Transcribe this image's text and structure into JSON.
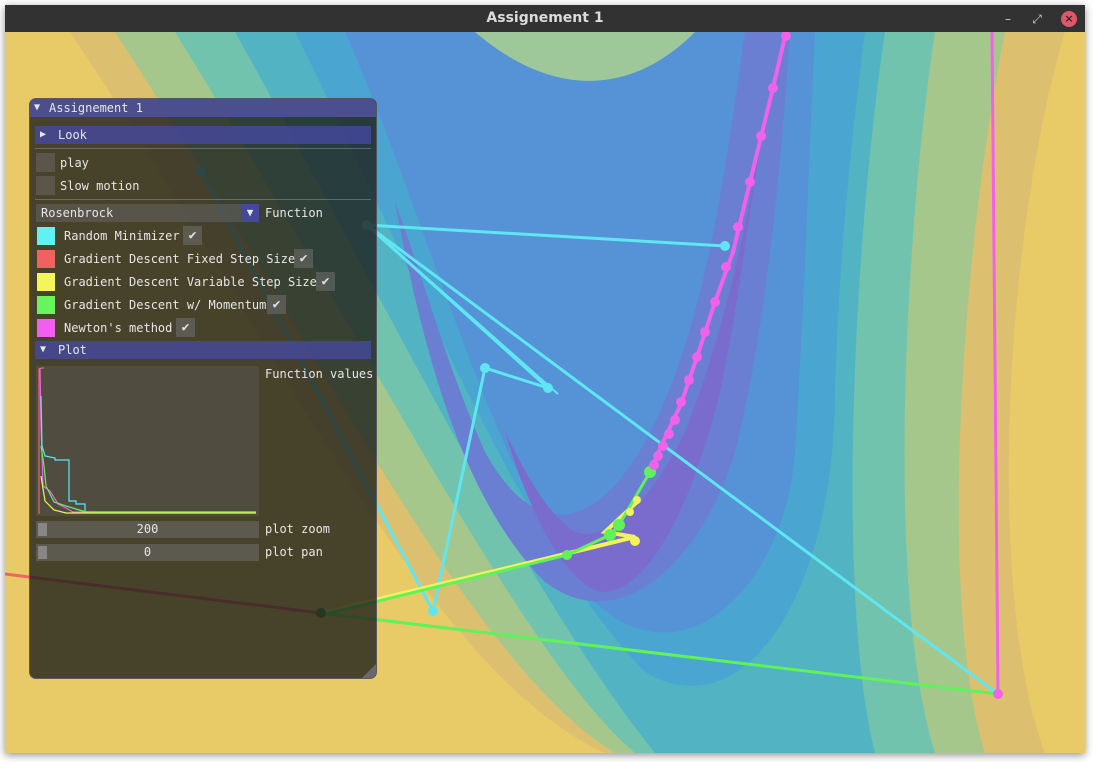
{
  "window": {
    "title": "Assignement 1",
    "minimize_glyph": "–",
    "restore_glyph": "⤢",
    "close_glyph": "×"
  },
  "panel": {
    "title": "Assignement 1",
    "title_arrow": "▼",
    "look_header": {
      "label": "Look",
      "arrow": "▶"
    },
    "play_label": "play",
    "slow_motion_label": "Slow motion",
    "function_select": {
      "value": "Rosenbrock",
      "label": "Function",
      "arrow": "▼"
    },
    "methods": [
      {
        "label": "Random Minimizer",
        "color": "#5ff2f2",
        "checked": true
      },
      {
        "label": "Gradient Descent Fixed Step Size",
        "color": "#f26060",
        "checked": true
      },
      {
        "label": "Gradient Descent Variable Step Size",
        "color": "#f5f55a",
        "checked": true
      },
      {
        "label": "Gradient Descent w/ Momentum",
        "color": "#66f55a",
        "checked": true
      },
      {
        "label": "Newton's method",
        "color": "#f25ff0",
        "checked": true
      }
    ],
    "check_glyph": "✔",
    "plot_header": {
      "label": "Plot",
      "arrow": "▼"
    },
    "plot_label": "Function values",
    "plot_zoom": {
      "value": "200",
      "label": "plot zoom"
    },
    "plot_pan": {
      "value": "0",
      "label": "plot pan"
    }
  },
  "colors": {
    "random": "#5fe6f2",
    "fixed": "#f06464",
    "variable": "#f2f25a",
    "momentum": "#5ff25a",
    "newton": "#f062ea"
  }
}
